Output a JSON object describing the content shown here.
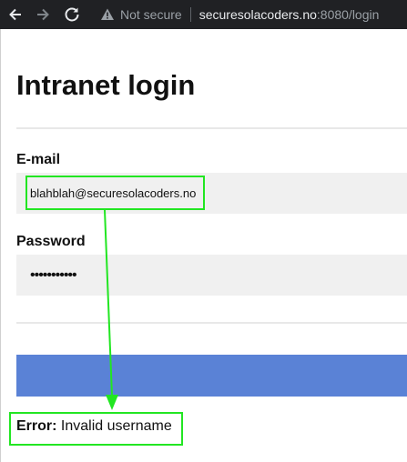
{
  "browser": {
    "not_secure_label": "Not secure",
    "url_host": "securesolacoders.no",
    "url_rest": ":8080/login",
    "icons": [
      "back-arrow-icon",
      "forward-arrow-icon",
      "reload-icon",
      "warning-icon"
    ]
  },
  "page": {
    "title": "Intranet login",
    "email_label": "E-mail",
    "email_value": "blahblah@securesolacoders.no",
    "password_label": "Password",
    "password_value": "•••••••••••",
    "submit_label": "",
    "error_prefix": "Error:",
    "error_message": "Invalid username"
  },
  "colors": {
    "browser_bar": "#202124",
    "input_bg": "#f0f0f0",
    "submit_bg": "#5a82d6",
    "annotation": "#22e622"
  }
}
